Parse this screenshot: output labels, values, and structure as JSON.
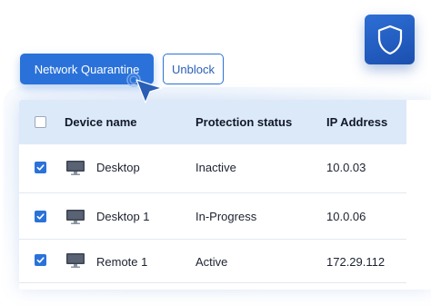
{
  "toolbar": {
    "quarantine_label": "Network Quarantine",
    "unblock_label": "Unblock"
  },
  "table": {
    "columns": [
      "Device name",
      "Protection status",
      "IP Address"
    ],
    "rows": [
      {
        "checked": true,
        "device": "Desktop",
        "status": "Inactive",
        "ip": "10.0.03"
      },
      {
        "checked": true,
        "device": "Desktop 1",
        "status": "In-Progress",
        "ip": "10.0.06"
      },
      {
        "checked": true,
        "device": "Remote 1",
        "status": "Active",
        "ip": "172.29.112"
      }
    ]
  },
  "icons": {
    "badge": "shield-icon",
    "device": "monitor-icon",
    "pointer": "cursor-click-icon",
    "check": "check-icon"
  },
  "colors": {
    "accent": "#2a72d9",
    "header_bg": "#dce9f9",
    "badge_bg": "#1b4fae"
  }
}
